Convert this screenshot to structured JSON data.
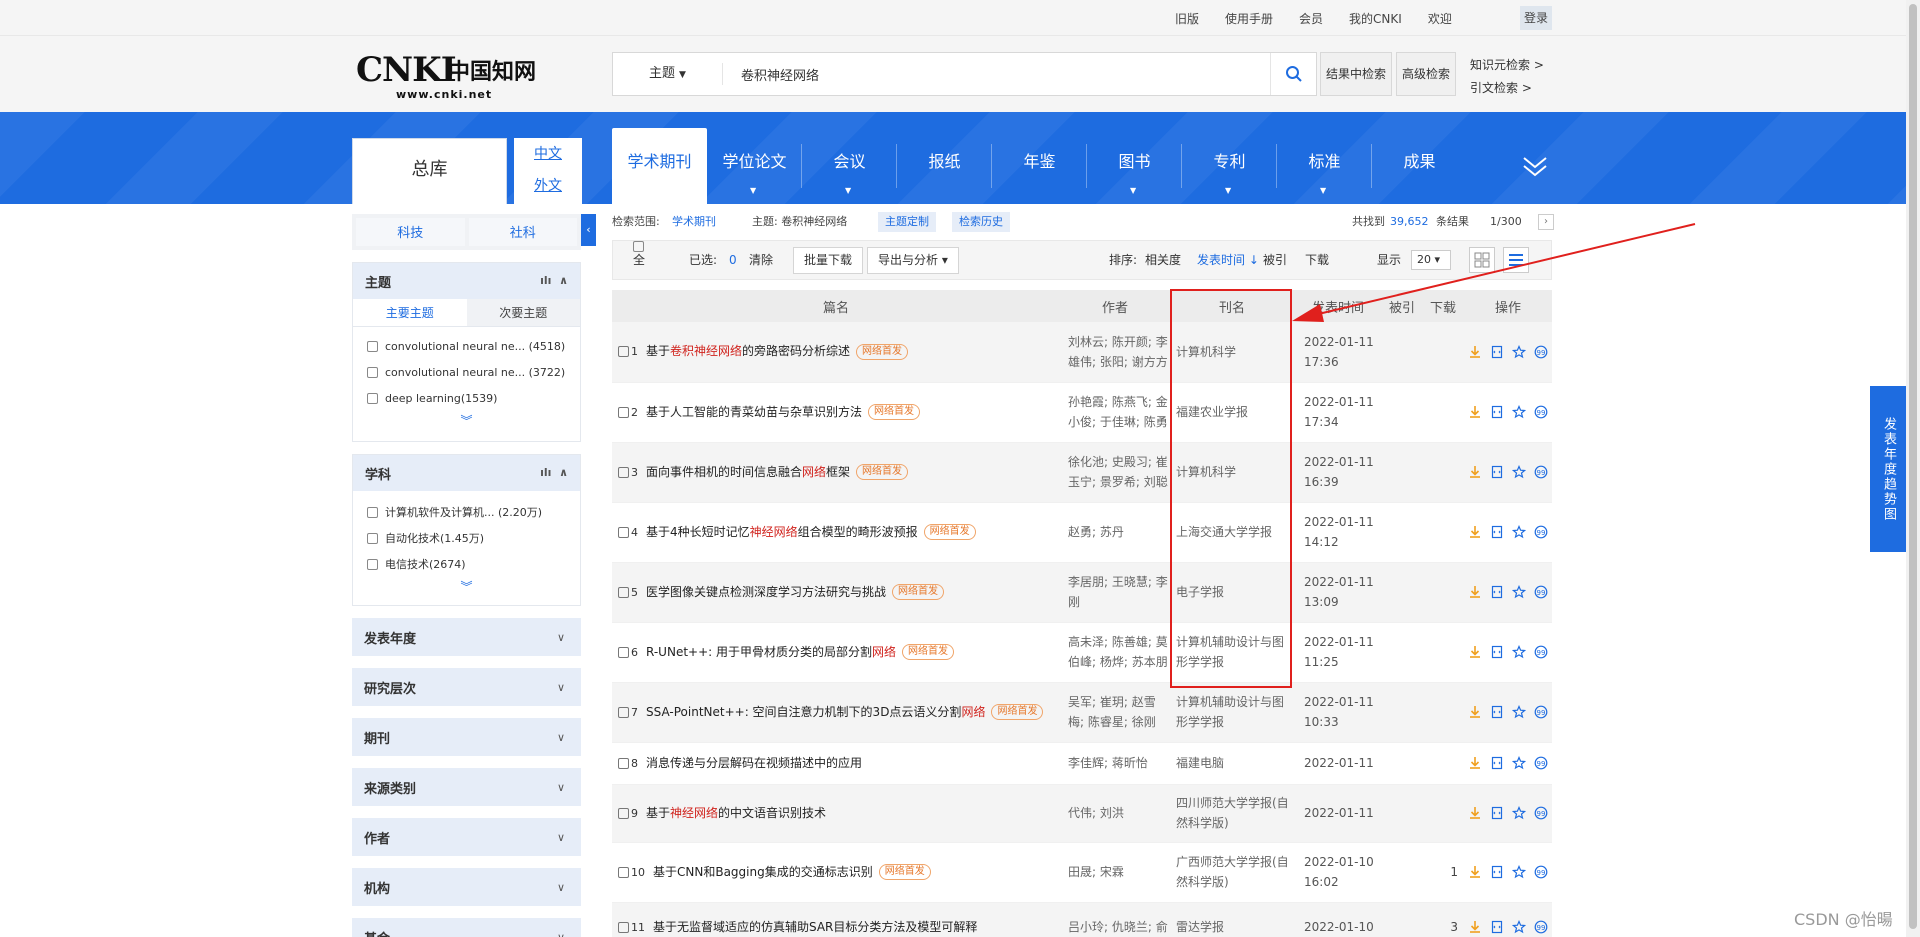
{
  "topbar": {
    "links": [
      "旧版",
      "使用手册",
      "会员",
      "我的CNKI",
      "欢迎"
    ],
    "login": "登录"
  },
  "header": {
    "logo_text": "CNKI",
    "logo_zh": "中国知网",
    "logo_url": "www.cnki.net",
    "search_type": "主题",
    "search_value": "卷积神经网络",
    "btn_in_results": "结果中检索",
    "btn_advanced": "高级检索",
    "link_knowledge": "知识元检索 >",
    "link_citation": "引文检索 >"
  },
  "nav": {
    "zongku": "总库",
    "lang_zh": "中文",
    "lang_en": "外文",
    "tabs": [
      {
        "label": "学术期刊",
        "active": true,
        "dropdown": false
      },
      {
        "label": "学位论文",
        "active": false,
        "dropdown": true
      },
      {
        "label": "会议",
        "active": false,
        "dropdown": true
      },
      {
        "label": "报纸",
        "active": false,
        "dropdown": false
      },
      {
        "label": "年鉴",
        "active": false,
        "dropdown": false
      },
      {
        "label": "图书",
        "active": false,
        "dropdown": true
      },
      {
        "label": "专利",
        "active": false,
        "dropdown": true
      },
      {
        "label": "标准",
        "active": false,
        "dropdown": true
      },
      {
        "label": "成果",
        "active": false,
        "dropdown": false
      }
    ]
  },
  "sidebar": {
    "kind_tabs": [
      "科技",
      "社科"
    ],
    "topic": {
      "title": "主题",
      "subtab_main": "主要主题",
      "subtab_secondary": "次要主题",
      "items": [
        "convolutional neural ne... (4518)",
        "convolutional neural ne... (3722)",
        "deep learning(1539)"
      ]
    },
    "subject": {
      "title": "学科",
      "items": [
        "计算机软件及计算机...  (2.20万)",
        "自动化技术(1.45万)",
        "电信技术(2674)"
      ]
    },
    "folds": [
      "发表年度",
      "研究层次",
      "期刊",
      "来源类别",
      "作者",
      "机构",
      "基金"
    ]
  },
  "scope": {
    "label": "检索范围:",
    "range": "学术期刊",
    "topic_label": "主题: 卷积神经网络",
    "custom": "主题定制",
    "history": "检索历史",
    "found_prefix": "共找到",
    "count": "39,652",
    "found_suffix": "条结果",
    "page": "1/300"
  },
  "toolbar": {
    "select_all": "全选",
    "selected_label": "已选:",
    "selected_count": "0",
    "clear": "清除",
    "batch_download": "批量下载",
    "export": "导出与分析 ▾",
    "sort_label": "排序:",
    "sort_relevance": "相关度",
    "sort_time": "发表时间 ↓",
    "sort_cited": "被引",
    "sort_download": "下载",
    "show_label": "显示",
    "page_size": "20 ▾"
  },
  "table": {
    "headers": [
      "篇名",
      "作者",
      "刊名",
      "发表时间",
      "被引",
      "下载",
      "操作"
    ],
    "rows": [
      {
        "n": "1",
        "pre": "基于",
        "hl": "卷积神经网络",
        "post": "的旁路密码分析综述",
        "badge": "网络首发",
        "author": "刘林云; 陈开颜; 李雄伟; 张阳; 谢方方",
        "source": "计算机科学",
        "date": "2022-01-11",
        "time": "17:36",
        "cite": "",
        "dl": ""
      },
      {
        "n": "2",
        "pre": "基于人工智能的青菜幼苗与杂草识别方法",
        "hl": "",
        "post": "",
        "badge": "网络首发",
        "author": "孙艳霞; 陈燕飞; 金小俊; 于佳琳; 陈勇",
        "source": "福建农业学报",
        "date": "2022-01-11",
        "time": "17:34",
        "cite": "",
        "dl": ""
      },
      {
        "n": "3",
        "pre": "面向事件相机的时间信息融合",
        "hl": "网络",
        "post": "框架",
        "badge": "网络首发",
        "author": "徐化池; 史殿习; 崔玉宁; 景罗希; 刘聪",
        "source": "计算机科学",
        "date": "2022-01-11",
        "time": "16:39",
        "cite": "",
        "dl": ""
      },
      {
        "n": "4",
        "pre": "基于4种长短时记忆",
        "hl": "神经网络",
        "post": "组合模型的畸形波预报",
        "badge": "网络首发",
        "author": "赵勇; 苏丹",
        "source": "上海交通大学学报",
        "date": "2022-01-11",
        "time": "14:12",
        "cite": "",
        "dl": ""
      },
      {
        "n": "5",
        "pre": "医学图像关键点检测深度学习方法研究与挑战",
        "hl": "",
        "post": "",
        "badge": "网络首发",
        "author": "李居朋; 王晓慧; 李刚",
        "source": "电子学报",
        "date": "2022-01-11",
        "time": "13:09",
        "cite": "",
        "dl": ""
      },
      {
        "n": "6",
        "pre": "R-UNet++: 用于甲骨材质分类的局部分割",
        "hl": "网络",
        "post": "",
        "badge": "网络首发",
        "author": "高未泽; 陈善雄; 莫伯峰; 杨烨; 苏本朋",
        "source": "计算机辅助设计与图形学学报",
        "date": "2022-01-11",
        "time": "11:25",
        "cite": "",
        "dl": ""
      },
      {
        "n": "7",
        "pre": "SSA-PointNet++: 空间自注意力机制下的3D点云语义分割",
        "hl": "网络",
        "post": "",
        "badge": "网络首发",
        "author": "吴军; 崔玥; 赵雪梅; 陈睿星; 徐刚",
        "source": "计算机辅助设计与图形学学报",
        "date": "2022-01-11",
        "time": "10:33",
        "cite": "",
        "dl": ""
      },
      {
        "n": "8",
        "pre": "消息传递与分层解码在视频描述中的应用",
        "hl": "",
        "post": "",
        "badge": "",
        "author": "李佳辉; 蒋昕怡",
        "source": "福建电脑",
        "date": "2022-01-11",
        "time": "",
        "cite": "",
        "dl": ""
      },
      {
        "n": "9",
        "pre": "基于",
        "hl": "神经网络",
        "post": "的中文语音识别技术",
        "badge": "",
        "author": "代伟; 刘洪",
        "source": "四川师范大学学报(自然科学版)",
        "date": "2022-01-11",
        "time": "",
        "cite": "",
        "dl": ""
      },
      {
        "n": "10",
        "pre": "基于CNN和Bagging集成的交通标志识别",
        "hl": "",
        "post": "",
        "badge": "网络首发",
        "author": "田晟; 宋霖",
        "source": "广西师范大学学报(自然科学版)",
        "date": "2022-01-10",
        "time": "16:02",
        "cite": "",
        "dl": "1"
      },
      {
        "n": "11",
        "pre": "基于无监督域适应的仿真辅助SAR目标分类方法及模型可解释",
        "hl": "",
        "post": "",
        "badge": "",
        "author": "吕小玲; 仇晓兰; 俞",
        "source": "雷达学报",
        "date": "2022-01-10",
        "time": "",
        "cite": "",
        "dl": "3"
      }
    ]
  },
  "trend_button": "发表年度趋势图",
  "watermark": "CSDN @怡暘",
  "colors": {
    "brand_blue": "#1e6ce0",
    "highlight_red": "#d0231d",
    "annotation_red": "#e0201d",
    "badge_orange": "#e6772a"
  }
}
